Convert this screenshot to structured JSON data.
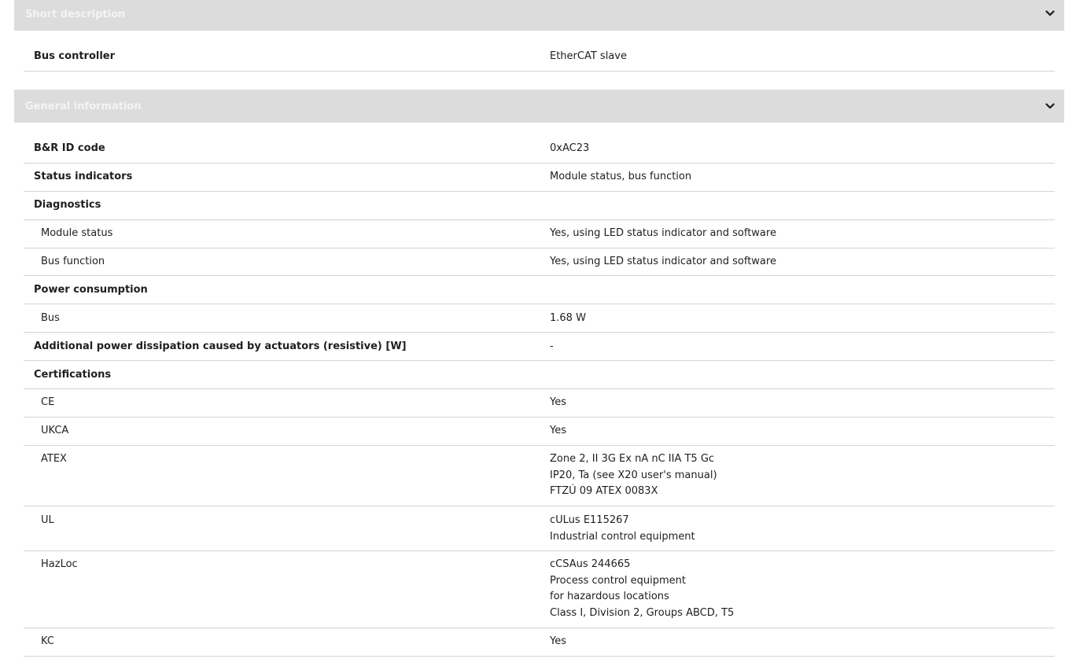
{
  "sections": [
    {
      "title": "Short description",
      "rows": [
        {
          "label": "Bus controller",
          "value": [
            "EtherCAT slave"
          ],
          "kind": "main"
        }
      ]
    },
    {
      "title": "General information",
      "rows": [
        {
          "label": "B&R ID code",
          "value": [
            "0xAC23"
          ],
          "kind": "main"
        },
        {
          "label": "Status indicators",
          "value": [
            "Module status, bus function"
          ],
          "kind": "main"
        },
        {
          "label": "Diagnostics",
          "value": [],
          "kind": "main"
        },
        {
          "label": "Module status",
          "value": [
            "Yes, using LED status indicator and software"
          ],
          "kind": "sub"
        },
        {
          "label": "Bus function",
          "value": [
            "Yes, using LED status indicator and software"
          ],
          "kind": "sub"
        },
        {
          "label": "Power consumption",
          "value": [],
          "kind": "main"
        },
        {
          "label": "Bus",
          "value": [
            "1.68 W"
          ],
          "kind": "sub"
        },
        {
          "label": "Additional power dissipation caused by actuators (resistive) [W]",
          "value": [
            "-"
          ],
          "kind": "main"
        },
        {
          "label": "Certifications",
          "value": [],
          "kind": "main"
        },
        {
          "label": "CE",
          "value": [
            "Yes"
          ],
          "kind": "sub"
        },
        {
          "label": "UKCA",
          "value": [
            "Yes"
          ],
          "kind": "sub"
        },
        {
          "label": "ATEX",
          "value": [
            "Zone 2, II 3G Ex nA nC IIA T5 Gc",
            "IP20, Ta (see X20 user's manual)",
            "FTZÚ 09 ATEX 0083X"
          ],
          "kind": "sub"
        },
        {
          "label": "UL",
          "value": [
            "cULus E115267",
            "Industrial control equipment"
          ],
          "kind": "sub"
        },
        {
          "label": "HazLoc",
          "value": [
            "cCSAus 244665",
            "Process control equipment",
            "for hazardous locations",
            "Class I, Division 2, Groups ABCD, T5"
          ],
          "kind": "sub"
        },
        {
          "label": "KC",
          "value": [
            "Yes"
          ],
          "kind": "sub"
        }
      ]
    }
  ],
  "icons": {
    "toggle": "chevron-down-icon"
  },
  "colors": {
    "header_bg": "#dcdcdc",
    "header_text": "#f4f4f4",
    "divider": "#d4d4d4"
  }
}
